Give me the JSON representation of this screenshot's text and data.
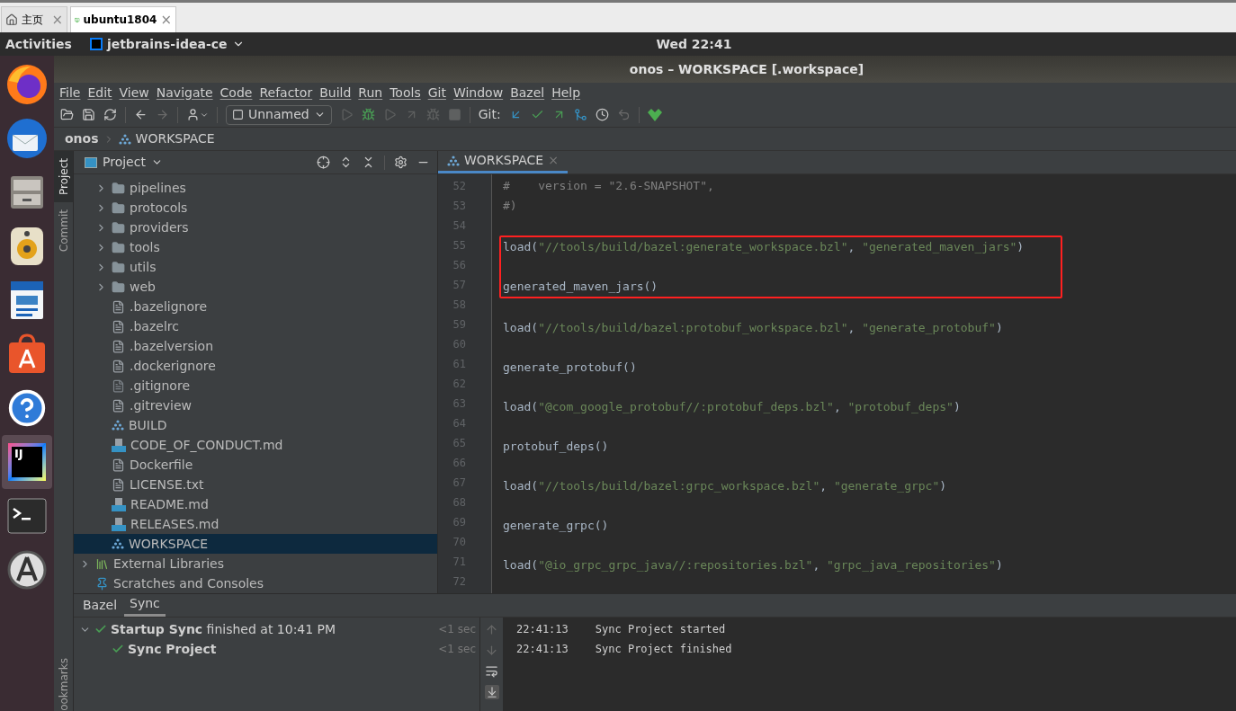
{
  "browser_tabs": [
    {
      "label": "主页",
      "kind": "home",
      "selected": false,
      "close": "×"
    },
    {
      "label": "ubuntu1804",
      "kind": "vm",
      "selected": true,
      "close": "×"
    }
  ],
  "top_bar": {
    "activities": "Activities",
    "app": "jetbrains-idea-ce",
    "clock": "Wed 22:41"
  },
  "dock": [
    {
      "kind": "firefox",
      "selected": false
    },
    {
      "kind": "mail",
      "selected": false
    },
    {
      "kind": "files",
      "selected": false
    },
    {
      "kind": "audio",
      "selected": false
    },
    {
      "kind": "writer",
      "selected": false
    },
    {
      "kind": "store",
      "selected": false
    },
    {
      "kind": "help",
      "selected": false
    },
    {
      "kind": "ide",
      "glyph": "IJ",
      "selected": true
    },
    {
      "kind": "terminal",
      "selected": false
    },
    {
      "kind": "updater",
      "selected": false
    }
  ],
  "window": {
    "title": "onos – WORKSPACE [.workspace]"
  },
  "menu": [
    "File",
    "Edit",
    "View",
    "Navigate",
    "Code",
    "Refactor",
    "Build",
    "Run",
    "Tools",
    "Git",
    "Window",
    "Bazel",
    "Help"
  ],
  "toolbar": {
    "run_config": "Unnamed",
    "git_label": "Git:"
  },
  "breadcrumb": [
    "onos",
    "WORKSPACE"
  ],
  "side_strip": [
    {
      "label": "Project",
      "selected": true
    },
    {
      "label": "Commit",
      "selected": false
    }
  ],
  "side_strip_bottom": "ookmarks",
  "project_panel": {
    "title": "Project",
    "tree": [
      {
        "label": "pipelines",
        "kind": "folder",
        "expanded": false,
        "selected": false
      },
      {
        "label": "protocols",
        "kind": "folder",
        "expanded": false,
        "selected": false
      },
      {
        "label": "providers",
        "kind": "folder",
        "expanded": false,
        "selected": false
      },
      {
        "label": "tools",
        "kind": "folder",
        "expanded": false,
        "selected": false
      },
      {
        "label": "utils",
        "kind": "folder",
        "expanded": false,
        "selected": false
      },
      {
        "label": "web",
        "kind": "folder",
        "expanded": false,
        "selected": false
      },
      {
        "label": ".bazelignore",
        "kind": "file",
        "selected": false
      },
      {
        "label": ".bazelrc",
        "kind": "file",
        "selected": false
      },
      {
        "label": ".bazelversion",
        "kind": "file",
        "selected": false
      },
      {
        "label": ".dockerignore",
        "kind": "file",
        "selected": false
      },
      {
        "label": ".gitignore",
        "kind": "ignored",
        "selected": false
      },
      {
        "label": ".gitreview",
        "kind": "file",
        "selected": false
      },
      {
        "label": "BUILD",
        "kind": "bazel",
        "selected": false
      },
      {
        "label": "CODE_OF_CONDUCT.md",
        "kind": "md",
        "selected": false
      },
      {
        "label": "Dockerfile",
        "kind": "file",
        "selected": false
      },
      {
        "label": "LICENSE.txt",
        "kind": "file",
        "selected": false
      },
      {
        "label": "README.md",
        "kind": "md",
        "selected": false
      },
      {
        "label": "RELEASES.md",
        "kind": "md",
        "selected": false
      },
      {
        "label": "WORKSPACE",
        "kind": "bazel",
        "selected": true
      }
    ],
    "top_items": [
      {
        "label": "External Libraries",
        "kind": "library",
        "expanded": false,
        "selected": false
      },
      {
        "label": "Scratches and Consoles",
        "kind": "scratches",
        "selected": false
      }
    ]
  },
  "editor": {
    "tab": {
      "label": "WORKSPACE",
      "close": "×",
      "selected": true
    },
    "lines": [
      {
        "number": "52",
        "segments": [
          {
            "kind": "comment",
            "text": "#    version = \"2.6-SNAPSHOT\","
          }
        ]
      },
      {
        "number": "53",
        "segments": [
          {
            "kind": "comment",
            "text": "#)"
          }
        ]
      },
      {
        "number": "54"
      },
      {
        "number": "55",
        "boxed": true,
        "segments": [
          {
            "kind": "plain",
            "text": "load("
          },
          {
            "kind": "string",
            "text": "\"//tools/build/bazel:generate_workspace.bzl\""
          },
          {
            "kind": "plain",
            "text": ", "
          },
          {
            "kind": "string",
            "text": "\"generated_maven_jars\""
          },
          {
            "kind": "plain",
            "text": ")"
          }
        ]
      },
      {
        "number": "56",
        "boxed": true
      },
      {
        "number": "57",
        "boxed": true,
        "segments": [
          {
            "kind": "plain",
            "text": "generated_maven_jars()"
          }
        ]
      },
      {
        "number": "58"
      },
      {
        "number": "59",
        "segments": [
          {
            "kind": "plain",
            "text": "load("
          },
          {
            "kind": "string",
            "text": "\"//tools/build/bazel:protobuf_workspace.bzl\""
          },
          {
            "kind": "plain",
            "text": ", "
          },
          {
            "kind": "string",
            "text": "\"generate_protobuf\""
          },
          {
            "kind": "plain",
            "text": ")"
          }
        ]
      },
      {
        "number": "60"
      },
      {
        "number": "61",
        "segments": [
          {
            "kind": "plain",
            "text": "generate_protobuf()"
          }
        ]
      },
      {
        "number": "62"
      },
      {
        "number": "63",
        "segments": [
          {
            "kind": "plain",
            "text": "load("
          },
          {
            "kind": "string",
            "text": "\"@com_google_protobuf//:protobuf_deps.bzl\""
          },
          {
            "kind": "plain",
            "text": ", "
          },
          {
            "kind": "string",
            "text": "\"protobuf_deps\""
          },
          {
            "kind": "plain",
            "text": ")"
          }
        ]
      },
      {
        "number": "64"
      },
      {
        "number": "65",
        "segments": [
          {
            "kind": "plain",
            "text": "protobuf_deps()"
          }
        ]
      },
      {
        "number": "66"
      },
      {
        "number": "67",
        "segments": [
          {
            "kind": "plain",
            "text": "load("
          },
          {
            "kind": "string",
            "text": "\"//tools/build/bazel:grpc_workspace.bzl\""
          },
          {
            "kind": "plain",
            "text": ", "
          },
          {
            "kind": "string",
            "text": "\"generate_grpc\""
          },
          {
            "kind": "plain",
            "text": ")"
          }
        ]
      },
      {
        "number": "68"
      },
      {
        "number": "69",
        "segments": [
          {
            "kind": "plain",
            "text": "generate_grpc()"
          }
        ]
      },
      {
        "number": "70"
      },
      {
        "number": "71",
        "segments": [
          {
            "kind": "plain",
            "text": "load("
          },
          {
            "kind": "string",
            "text": "\"@io_grpc_grpc_java//:repositories.bzl\""
          },
          {
            "kind": "plain",
            "text": ", "
          },
          {
            "kind": "string",
            "text": "\"grpc_java_repositories\""
          },
          {
            "kind": "plain",
            "text": ")"
          }
        ]
      },
      {
        "number": "72"
      }
    ]
  },
  "bottom_panel": {
    "tabs": [
      {
        "label": "Bazel",
        "selected": false
      },
      {
        "label": "Sync",
        "selected": true
      }
    ],
    "sync_tree": [
      {
        "label": "**Startup Sync** finished at 10:41 PM",
        "duration": "<1 sec",
        "expanded": true,
        "children": [
          {
            "label": "Sync Project",
            "duration": "<1 sec"
          }
        ]
      }
    ],
    "console": [
      {
        "time": "22:41:13",
        "message": "Sync Project started"
      },
      {
        "time": "22:41:13",
        "message": "Sync Project finished"
      }
    ]
  }
}
